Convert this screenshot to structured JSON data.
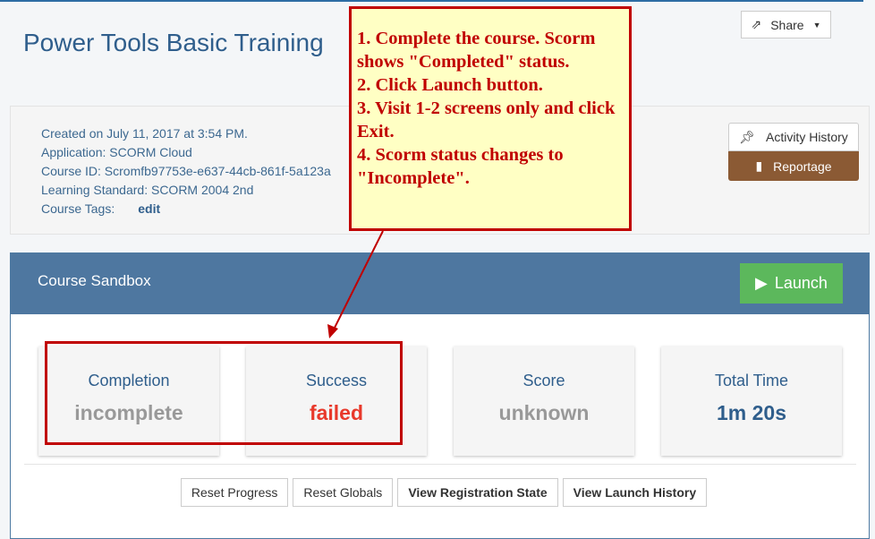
{
  "header": {
    "title": "Power Tools Basic Training",
    "share_label": "Share"
  },
  "info": {
    "created": "Created on July 11, 2017 at 3:54 PM.",
    "application": "Application: SCORM Cloud",
    "course_id": "Course ID: Scromfb97753e-e637-44cb-861f-5a123a",
    "standard": "Learning Standard: SCORM 2004 2nd",
    "tags_label": "Course Tags:",
    "edit": "edit"
  },
  "actions": {
    "activity_history": "Activity History",
    "reportage": "Reportage"
  },
  "sandbox": {
    "title": "Course Sandbox",
    "launch": "Launch",
    "cards": [
      {
        "label": "Completion",
        "value": "incomplete",
        "color": "#999999"
      },
      {
        "label": "Success",
        "value": "failed",
        "color": "#e8392b"
      },
      {
        "label": "Score",
        "value": "unknown",
        "color": "#999999"
      },
      {
        "label": "Total Time",
        "value": "1m 20s",
        "color": "#2f5e8c"
      }
    ],
    "buttons": [
      "Reset Progress",
      "Reset Globals",
      "View Registration State",
      "View Launch History"
    ]
  },
  "annotation": {
    "text": "1. Complete the course. Scorm shows \"Completed\" status.\n2. Click Launch button.\n3. Visit 1-2 screens only and click Exit.\n4. Scorm status changes to \"Incomplete\"."
  }
}
